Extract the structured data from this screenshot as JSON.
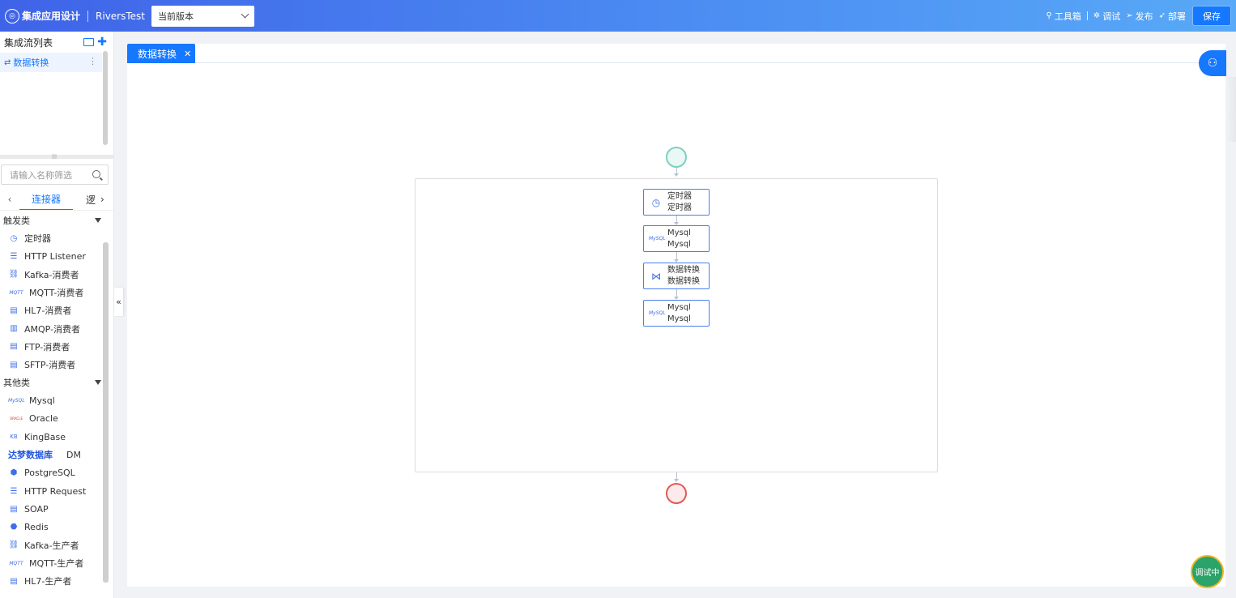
{
  "header": {
    "app_title": "集成应用设计",
    "project": "RiversTest",
    "version": "当前版本",
    "toolbox": "工具箱",
    "debug": "调试",
    "publish": "发布",
    "deploy": "部署",
    "save": "保存"
  },
  "sidebar": {
    "flow_list_title": "集成流列表",
    "flow_item": "数据转换",
    "search_placeholder": "请输入名称筛选",
    "tab_active": "连接器",
    "tab_next": "逻",
    "categories": [
      {
        "label": "触发类",
        "items": [
          "定时器",
          "HTTP Listener",
          "Kafka-消费者",
          "MQTT-消费者",
          "HL7-消费者",
          "AMQP-消费者",
          "FTP-消费者",
          "SFTP-消费者"
        ]
      },
      {
        "label": "其他类",
        "items": [
          "Mysql",
          "Oracle",
          "KingBase",
          "DM",
          "PostgreSQL",
          "HTTP Request",
          "SOAP",
          "Redis",
          "Kafka-生产者",
          "MQTT-生产者",
          "HL7-生产者"
        ]
      }
    ],
    "dm_logo_text": "达梦数据库",
    "mysql_logo_text": "MySQL",
    "oracle_logo_text": "ORACLE",
    "kingbase_logo_text": "KB",
    "mqtt_logo_text": "MQTT"
  },
  "editor": {
    "tab": "数据转换",
    "nodes": [
      {
        "title": "定时器",
        "subtitle": "定时器",
        "icon": "timer-icon"
      },
      {
        "title": "Mysql",
        "subtitle": "Mysql",
        "icon": "mysql-logo"
      },
      {
        "title": "数据转换",
        "subtitle": "数据转换",
        "icon": "transform-icon"
      },
      {
        "title": "Mysql",
        "subtitle": "Mysql",
        "icon": "mysql-logo"
      }
    ],
    "status": "调试中"
  },
  "colors": {
    "primary": "#1677ff",
    "start_node": "#7fcfbf",
    "end_node": "#e05a5a",
    "status": "#2ba36a"
  }
}
